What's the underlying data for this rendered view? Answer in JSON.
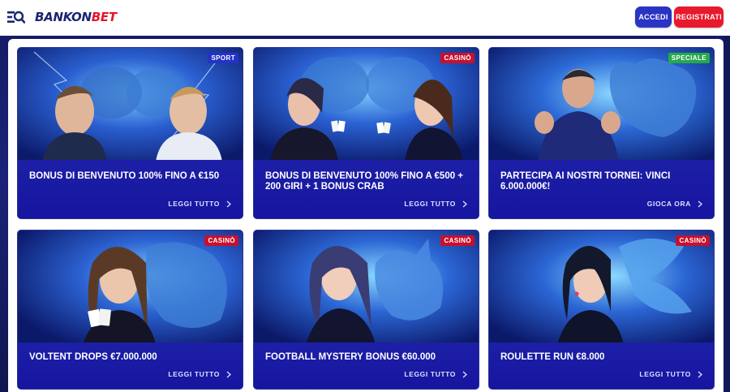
{
  "header": {
    "brand_main": "BANKON",
    "brand_accent": "BET",
    "login_label": "ACCEDI",
    "register_label": "REGISTRATI"
  },
  "promos": [
    {
      "badge": "SPORT",
      "badge_color": "#2433c4",
      "title": "BONUS DI BENVENUTO 100% FINO A €150",
      "cta": "LEGGI TUTTO",
      "art": "two-men-lions"
    },
    {
      "badge": "CASINÒ",
      "badge_color": "#c8102e",
      "title": "BONUS DI BENVENUTO 100% FINO A €500 + 200 GIRI + 1 BONUS CRAB",
      "cta": "LEGGI TUTTO",
      "art": "two-women-cards-lions"
    },
    {
      "badge": "SPECIALE",
      "badge_color": "#27a84a",
      "title": "PARTECIPA AI NOSTRI TORNEI: VINCI 6.000.000€!",
      "cta": "GIOCA ORA",
      "art": "man-with-bull"
    },
    {
      "badge": "CASINÒ",
      "badge_color": "#c8102e",
      "title": "VOLTENT DROPS €7.000.000",
      "cta": "LEGGI TUTTO",
      "art": "woman-cards-lion"
    },
    {
      "badge": "CASINÒ",
      "badge_color": "#c8102e",
      "title": "FOOTBALL MYSTERY BONUS €60.000",
      "cta": "LEGGI TUTTO",
      "art": "woman-with-deer"
    },
    {
      "badge": "CASINÒ",
      "badge_color": "#c8102e",
      "title": "ROULETTE RUN €8.000",
      "cta": "LEGGI TUTTO",
      "art": "woman-with-butterfly"
    }
  ]
}
